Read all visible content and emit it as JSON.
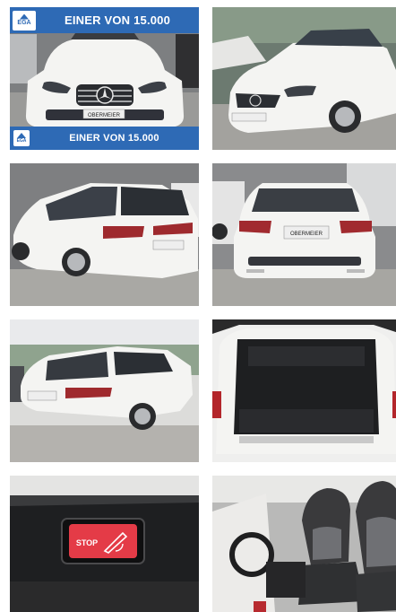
{
  "gallery": {
    "banner": {
      "text": "EINER VON 15.000",
      "logo_text": "EGA"
    },
    "photos": [
      {
        "subject": "front view",
        "plate": "OBERMEIER"
      },
      {
        "subject": "front three-quarter view",
        "plate": ""
      },
      {
        "subject": "rear three-quarter view",
        "plate": ""
      },
      {
        "subject": "rear view",
        "plate": "OBERMEIER"
      },
      {
        "subject": "rear three-quarter view showroom",
        "plate": ""
      },
      {
        "subject": "open trunk",
        "plate": ""
      },
      {
        "subject": "trunk stop button",
        "stop_label": "STOP"
      },
      {
        "subject": "front seats interior",
        "plate": ""
      }
    ],
    "colors": {
      "banner": "#2e6ab5",
      "car_white": "#f4f4f2",
      "stop_button": "#e43b47"
    }
  }
}
